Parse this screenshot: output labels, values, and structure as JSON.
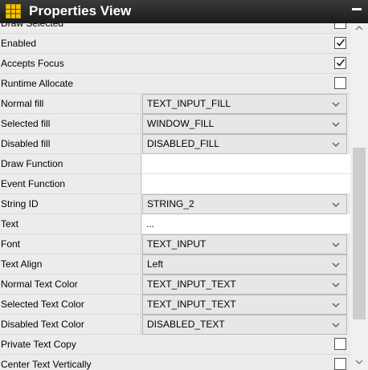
{
  "window": {
    "title": "Properties View",
    "title_icon": "grid-icon",
    "minimize_icon": "minimize-icon"
  },
  "properties": [
    {
      "label": "Draw Selected",
      "type": "checkbox",
      "checked": false
    },
    {
      "label": "Enabled",
      "type": "checkbox",
      "checked": true
    },
    {
      "label": "Accepts Focus",
      "type": "checkbox",
      "checked": true
    },
    {
      "label": "Runtime Allocate",
      "type": "checkbox",
      "checked": false
    },
    {
      "label": "Normal fill",
      "type": "select",
      "value": "TEXT_INPUT_FILL"
    },
    {
      "label": "Selected fill",
      "type": "select",
      "value": "WINDOW_FILL"
    },
    {
      "label": "Disabled fill",
      "type": "select",
      "value": "DISABLED_FILL"
    },
    {
      "label": "Draw Function",
      "type": "text",
      "value": ""
    },
    {
      "label": "Event Function",
      "type": "text",
      "value": ""
    },
    {
      "label": "String ID",
      "type": "select",
      "value": "STRING_2"
    },
    {
      "label": "Text",
      "type": "text",
      "value": "..."
    },
    {
      "label": "Font",
      "type": "select",
      "value": "TEXT_INPUT"
    },
    {
      "label": "Text Align",
      "type": "select",
      "value": "Left"
    },
    {
      "label": "Normal Text Color",
      "type": "select",
      "value": "TEXT_INPUT_TEXT"
    },
    {
      "label": "Selected Text Color",
      "type": "select",
      "value": "TEXT_INPUT_TEXT"
    },
    {
      "label": "Disabled Text Color",
      "type": "select",
      "value": "DISABLED_TEXT"
    },
    {
      "label": "Private Text Copy",
      "type": "checkbox",
      "checked": false
    },
    {
      "label": "Center Text Vertically",
      "type": "checkbox",
      "checked": false
    }
  ],
  "colors": {
    "titlebar": "#2a2a2a",
    "row": "#ececec",
    "grid_icon": "#f5c400"
  }
}
